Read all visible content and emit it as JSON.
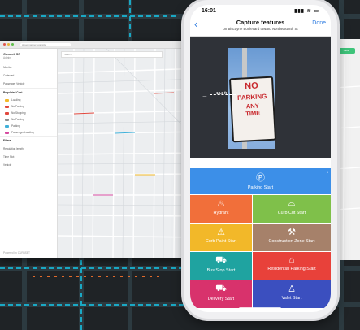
{
  "desktop": {
    "url": "streetmapper.example",
    "side": {
      "title": "Council SF",
      "sub": "Admin",
      "rows": [
        "Monitor",
        "Collected",
        "Passenger Vehicle"
      ],
      "sec_regulated": "Regulated Cost",
      "items": [
        {
          "label": "Loading",
          "color": "#f2b829"
        },
        {
          "label": "No Parking",
          "color": "#e1473d"
        },
        {
          "label": "No Stopping",
          "color": "#e1473d"
        },
        {
          "label": "No Parking",
          "color": "#8e8e8e"
        },
        {
          "label": "Parking",
          "color": "#3fb0d9"
        },
        {
          "label": "Passenger Loading",
          "color": "#d64aa0"
        }
      ],
      "sec_filters": "Filters",
      "filter_rows": [
        "Regulation length",
        "Time Slot",
        "Vehicle"
      ],
      "footer": "Powered by CURBSET"
    },
    "search_placeholder": "Search"
  },
  "right_window": {
    "button": "Save"
  },
  "phone": {
    "time": "16:01",
    "status_icons": "▮▮▮ ≋ ▭",
    "back": "‹",
    "title": "Capture features",
    "subtitle": "on Biscayne Boulevard toward Northeast 8th St",
    "done": "Done",
    "distance": "13.3 ft",
    "sign": {
      "l1": "NO",
      "l2": "PARKING",
      "l3": "ANY",
      "l4": "TIME"
    },
    "tiles": [
      {
        "label": "Parking Start",
        "icon": "Ⓟ",
        "color": "#3c8fe8"
      },
      {
        "label": "Hydrant",
        "icon": "♨",
        "color": "#f16f3a"
      },
      {
        "label": "Curb Cut Start",
        "icon": "⌓",
        "color": "#7fc04a"
      },
      {
        "label": "Curb Paint Start",
        "icon": "⚠",
        "color": "#f2b829"
      },
      {
        "label": "Construction Zone Start",
        "icon": "⚒",
        "color": "#a6816a"
      },
      {
        "label": "Bus Stop Start",
        "icon": "⛟",
        "color": "#1fa3a0"
      },
      {
        "label": "Residential Parking Start",
        "icon": "⌂",
        "color": "#e8413a"
      },
      {
        "label": "Delivery Start",
        "icon": "⛟",
        "color": "#d8326c"
      },
      {
        "label": "Valet Start",
        "icon": "♙",
        "color": "#3b4fbf"
      }
    ]
  }
}
